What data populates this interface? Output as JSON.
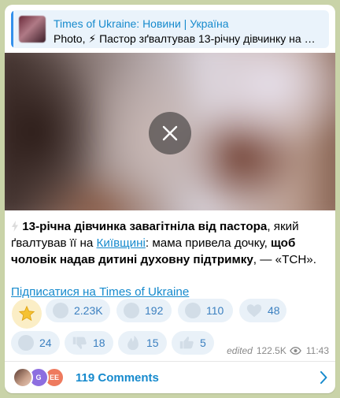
{
  "reply": {
    "title": "Times of Ukraine: Новини | Україна",
    "text": "Photo, ⚡ Пастор зґвалтував 13-річну дівчинку на К…"
  },
  "media": {
    "close_icon": "close-icon"
  },
  "post": {
    "line_bold_1": "13-річна дівчинка завагітніла від пастора",
    "line_plain_1": ", який ґвалтував її на ",
    "link_region": "Київщині",
    "line_plain_2": ": мама привела дочку, ",
    "line_bold_2": "щоб чоловік надав дитині духовну підтримку",
    "line_plain_3": ", — «ТСН»."
  },
  "subscribe_link": "Підписатися на Times of Ukraine",
  "reactions": [
    {
      "icon": "reaction-1-icon",
      "count": "2.23K"
    },
    {
      "icon": "reaction-2-icon",
      "count": "192"
    },
    {
      "icon": "reaction-3-icon",
      "count": "110"
    },
    {
      "icon": "heart-icon",
      "count": "48"
    },
    {
      "icon": "reaction-5-icon",
      "count": "24"
    },
    {
      "icon": "thumbs-down-icon",
      "count": "18"
    },
    {
      "icon": "fire-icon",
      "count": "15"
    },
    {
      "icon": "thumbs-up-icon",
      "count": "5"
    }
  ],
  "meta": {
    "edited": "edited",
    "views": "122.5K",
    "time": "11:43"
  },
  "comments": {
    "avatars": [
      "",
      "G",
      "EE"
    ],
    "label": "119 Comments"
  },
  "colors": {
    "accent": "#168acd",
    "reaction_bg": "#e9f1f8",
    "reaction_text": "#3c80c0"
  }
}
